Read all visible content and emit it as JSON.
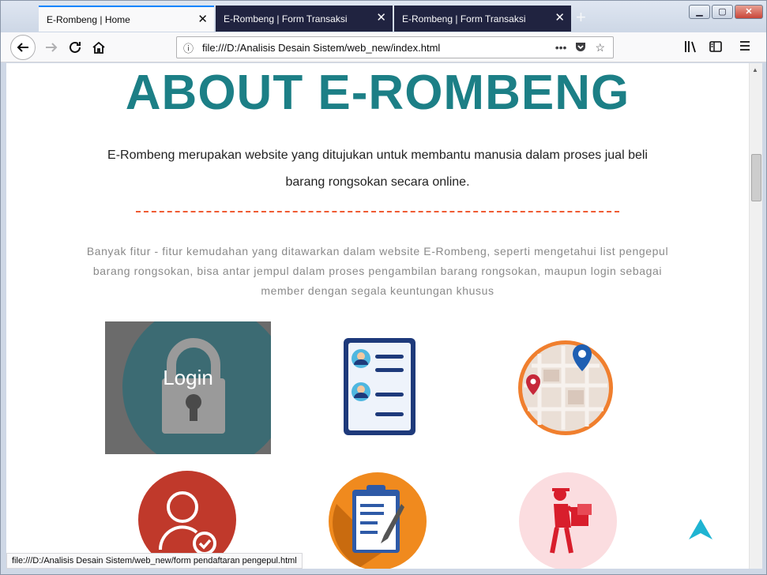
{
  "browser": {
    "tabs": [
      {
        "label": "E-Rombeng | Home"
      },
      {
        "label": "E-Rombeng | Form Transaksi"
      },
      {
        "label": "E-Rombeng | Form Transaksi"
      }
    ],
    "new_tab": "+",
    "url": "file:///D:/Analisis Desain Sistem/web_new/index.html",
    "status_text": "file:///D:/Analisis Desain Sistem/web_new/form pendaftaran pengepul.html"
  },
  "page": {
    "title": "ABOUT E-ROMBENG",
    "lead": "E-Rombeng merupakan website yang ditujukan untuk membantu manusia dalam proses jual beli barang rongsokan secara online.",
    "description": "Banyak fitur - fitur kemudahan yang ditawarkan dalam website E-Rombeng, seperti mengetahui list pengepul barang rongsokan, bisa antar jempul dalam proses pengambilan barang rongsokan, maupun login sebagai member dengan segala keuntungan khusus",
    "features": [
      {
        "name": "login-feature",
        "label": "Login",
        "icon": "padlock-icon"
      },
      {
        "name": "pengepul-list-feature",
        "icon": "contact-list-icon"
      },
      {
        "name": "map-feature",
        "icon": "map-pin-icon"
      },
      {
        "name": "member-feature",
        "icon": "user-check-icon"
      },
      {
        "name": "transaction-form-feature",
        "icon": "clipboard-icon"
      },
      {
        "name": "pickup-feature",
        "icon": "delivery-man-icon"
      }
    ]
  },
  "colors": {
    "title": "#1c7f86",
    "divider": "#ef5b33",
    "scroll_top": "#1fb4d2"
  }
}
